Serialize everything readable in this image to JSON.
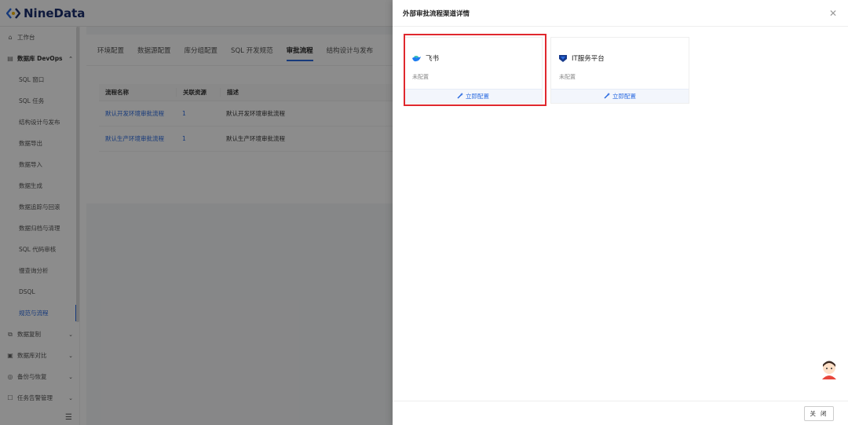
{
  "app": {
    "logo_text": "NineData"
  },
  "sidebar": {
    "items": [
      {
        "label": "工作台",
        "icon": "home-icon",
        "kind": "top"
      },
      {
        "label": "数据库 DevOps",
        "icon": "database-icon",
        "kind": "group",
        "caret": "^"
      },
      {
        "label": "SQL 窗口",
        "kind": "sub"
      },
      {
        "label": "SQL 任务",
        "kind": "sub"
      },
      {
        "label": "结构设计与发布",
        "kind": "sub"
      },
      {
        "label": "数据导出",
        "kind": "sub"
      },
      {
        "label": "数据导入",
        "kind": "sub"
      },
      {
        "label": "数据生成",
        "kind": "sub"
      },
      {
        "label": "数据追踪与回滚",
        "kind": "sub"
      },
      {
        "label": "数据归档与清理",
        "kind": "sub"
      },
      {
        "label": "SQL 代码审核",
        "kind": "sub"
      },
      {
        "label": "慢查询分析",
        "kind": "sub"
      },
      {
        "label": "DSQL",
        "kind": "sub"
      },
      {
        "label": "规范与流程",
        "kind": "sub",
        "active": true
      },
      {
        "label": "数据复制",
        "icon": "copy-icon",
        "kind": "top",
        "caret": "v"
      },
      {
        "label": "数据库对比",
        "icon": "compare-icon",
        "kind": "top",
        "caret": "v"
      },
      {
        "label": "备份与恢复",
        "icon": "backup-icon",
        "kind": "top",
        "caret": "v"
      },
      {
        "label": "任务告警管理",
        "icon": "alert-icon",
        "kind": "top",
        "caret": "v"
      }
    ],
    "collapse_icon": "menu-collapse-icon"
  },
  "main": {
    "tabs": [
      "环境配置",
      "数据源配置",
      "库分组配置",
      "SQL 开发规范",
      "审批流程",
      "结构设计与发布"
    ],
    "active_tab": "审批流程",
    "table": {
      "headers": [
        "流程名称",
        "关联资源",
        "描述"
      ],
      "rows": [
        {
          "name": "默认开发环境审批流程",
          "count": "1",
          "desc": "默认开发环境审批流程"
        },
        {
          "name": "默认生产环境审批流程",
          "count": "1",
          "desc": "默认生产环境审批流程"
        }
      ]
    }
  },
  "drawer": {
    "title": "外部审批流程渠道详情",
    "close_icon": "close-icon",
    "cards": [
      {
        "name": "飞书",
        "status": "未配置",
        "action": "立即配置",
        "icon": "feishu-icon",
        "highlighted": true
      },
      {
        "name": "IT服务平台",
        "status": "未配置",
        "action": "立即配置",
        "icon": "itsm-icon"
      }
    ],
    "footer": {
      "close_label": "关 闭"
    },
    "assistant_icon": "assistant-avatar-icon"
  },
  "colors": {
    "accent": "#2b6be0",
    "highlight": "#e0282e",
    "brand": "#1a2e6e"
  }
}
